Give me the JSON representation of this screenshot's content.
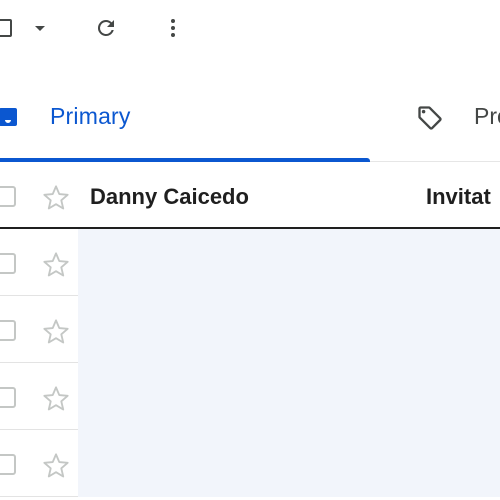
{
  "toolbar": {
    "select_all_icon": "checkbox-icon",
    "select_menu_icon": "caret-down-icon",
    "refresh_icon": "refresh-icon",
    "more_icon": "more-vert-icon"
  },
  "tabs": [
    {
      "label": "Primary",
      "icon": "inbox-icon",
      "selected": true
    },
    {
      "label": "Pro",
      "icon": "tag-icon",
      "selected": false
    }
  ],
  "colors": {
    "accent": "#0b57d0",
    "read_row_bg": "#f2f5fb",
    "text": "#1f1f1f"
  },
  "emails": [
    {
      "sender": "Danny Caicedo",
      "subject": "Invitat",
      "unread": true
    },
    {
      "sender": "",
      "subject": "",
      "unread": false
    },
    {
      "sender": "",
      "subject": "",
      "unread": false
    },
    {
      "sender": "",
      "subject": "",
      "unread": false
    },
    {
      "sender": "",
      "subject": "",
      "unread": false
    }
  ]
}
